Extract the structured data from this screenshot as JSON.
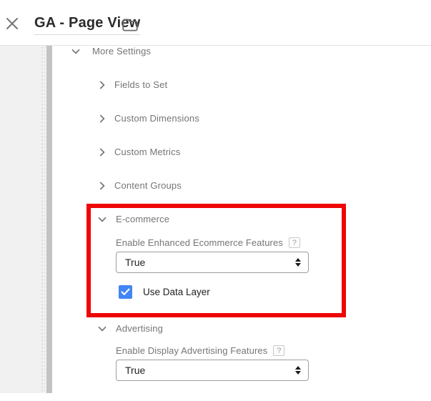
{
  "header": {
    "title": "GA - Page View",
    "close_icon": "close-x",
    "folder_icon": "folder-outline"
  },
  "sections": {
    "more_settings": {
      "label": "More Settings",
      "state": "expanded"
    },
    "collapsed": [
      {
        "label": "Fields to Set"
      },
      {
        "label": "Custom Dimensions"
      },
      {
        "label": "Custom Metrics"
      },
      {
        "label": "Content Groups"
      }
    ],
    "ecommerce": {
      "label": "E-commerce",
      "state": "expanded",
      "field_label": "Enable Enhanced Ecommerce Features",
      "help_glyph": "?",
      "select_value": "True",
      "checkbox_label": "Use Data Layer",
      "checkbox_checked": true
    },
    "advertising": {
      "label": "Advertising",
      "state": "expanded",
      "field_label": "Enable Display Advertising Features",
      "help_glyph": "?",
      "select_value": "True"
    }
  },
  "annotation": {
    "type": "red-highlight-box",
    "highlights": "E-commerce section"
  },
  "colors": {
    "checkbox_blue": "#4285f4",
    "annotation_red": "#ee0505",
    "section_text": "#757575",
    "value_text": "#212121",
    "left_panel": "#f1f1f1",
    "scrollbar_thumb": "#c3c3c3"
  }
}
